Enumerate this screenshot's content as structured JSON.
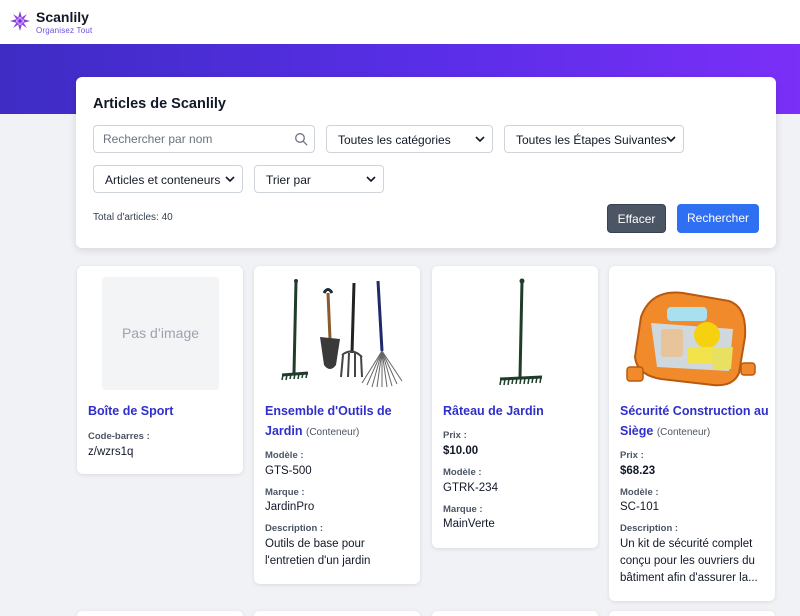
{
  "header": {
    "app_name": "Scanlily",
    "tagline": "Organisez Tout",
    "accent": "#7b2ff7"
  },
  "panel": {
    "title": "Articles de Scanlily",
    "search_placeholder": "Rechercher par nom",
    "category_select": "Toutes les catégories",
    "steps_select": "Toutes les Étapes Suivantes",
    "type_select": "Articles et conteneurs",
    "sort_select": "Trier par",
    "total": "Total d'articles: 40",
    "clear_label": "Effacer",
    "search_label": "Rechercher"
  },
  "cards": [
    {
      "title": "Boîte de Sport",
      "no_image": "Pas d’image",
      "image_icon": "none",
      "barcode_label": "Code-barres :",
      "barcode": "z/wzrs1q"
    },
    {
      "title": "Ensemble d'Outils de Jardin",
      "kind": "(Conteneur)",
      "image_icon": "garden-tools-icon",
      "model_label": "Modèle :",
      "model": "GTS-500",
      "brand_label": "Marque :",
      "brand": "JardinPro",
      "desc_label": "Description :",
      "description": "Outils de base pour l'entretien d'un jardin"
    },
    {
      "title": "Râteau de Jardin",
      "image_icon": "rake-icon",
      "price_label": "Prix :",
      "price": "$10.00",
      "model_label": "Modèle :",
      "model": "GTRK-234",
      "brand_label": "Marque :",
      "brand": "MainVerte"
    },
    {
      "title": "Sécurité Construction au Siège",
      "kind": "(Conteneur)",
      "image_icon": "safety-kit-icon",
      "price_label": "Prix :",
      "price": "$68.23",
      "model_label": "Modèle :",
      "model": "SC-101",
      "desc_label": "Description :",
      "description": "Un kit de sécurité complet conçu pour les ouvriers du bâtiment afin d'assurer la..."
    }
  ]
}
